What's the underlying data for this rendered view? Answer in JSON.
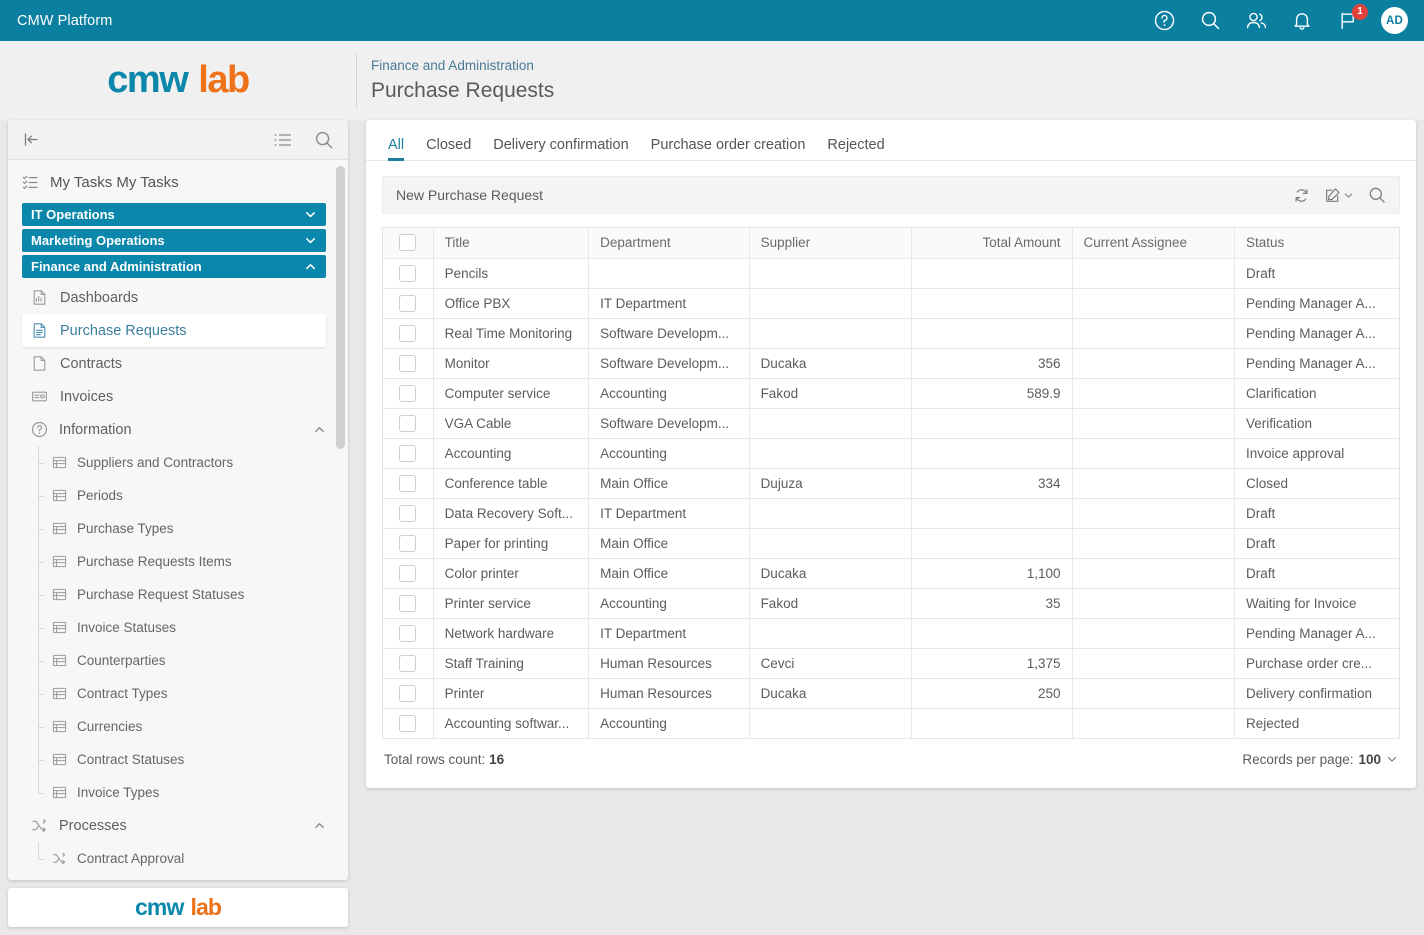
{
  "topbar": {
    "title": "CMW Platform",
    "icons": [
      {
        "name": "help-icon",
        "label": "?"
      },
      {
        "name": "search-icon",
        "label": "Search"
      },
      {
        "name": "people-icon",
        "label": "People"
      },
      {
        "name": "notifications-bell-icon",
        "label": "Notifications"
      },
      {
        "name": "flag-icon",
        "label": "Flags"
      }
    ],
    "flag_badge_count": "1",
    "avatar_initials": "AD",
    "background_color": "#0b7fa0"
  },
  "header": {
    "logo_primary": "cmw",
    "logo_secondary": "lab",
    "breadcrumb": "Finance and Administration",
    "page_title": "Purchase Requests",
    "logo_primary_color": "#0b87ab",
    "logo_secondary_color": "#ee7219"
  },
  "sidebar": {
    "collapse_label": "Collapse",
    "list_view_label": "List view",
    "search_label": "Search",
    "my_tasks": "My Tasks My Tasks",
    "groups": [
      {
        "label": "IT Operations",
        "expanded": false
      },
      {
        "label": "Marketing Operations",
        "expanded": false
      },
      {
        "label": "Finance and Administration",
        "expanded": true
      }
    ],
    "items": [
      {
        "label": "Dashboards",
        "icon": "dashboard-page-icon",
        "active": false
      },
      {
        "label": "Purchase Requests",
        "icon": "document-lines-icon",
        "active": true
      },
      {
        "label": "Contracts",
        "icon": "blank-page-icon",
        "active": false
      },
      {
        "label": "Invoices",
        "icon": "invoice-card-icon",
        "active": false
      }
    ],
    "information_section": {
      "label": "Information",
      "expanded": true,
      "items": [
        "Suppliers and Contractors",
        "Periods",
        "Purchase Types",
        "Purchase Requests Items",
        "Purchase Request Statuses",
        "Invoice Statuses",
        "Counterparties",
        "Contract Types",
        "Currencies",
        "Contract Statuses",
        "Invoice Types"
      ]
    },
    "processes_section": {
      "label": "Processes",
      "expanded": true,
      "items": [
        "Contract Approval"
      ]
    },
    "footer_logo_primary": "cmw",
    "footer_logo_secondary": "lab"
  },
  "main": {
    "tabs": [
      {
        "label": "All",
        "active": true
      },
      {
        "label": "Closed",
        "active": false
      },
      {
        "label": "Delivery confirmation",
        "active": false
      },
      {
        "label": "Purchase order creation",
        "active": false
      },
      {
        "label": "Rejected",
        "active": false
      }
    ],
    "toolbar": {
      "new_record_label": "New Purchase Request",
      "refresh_label": "Refresh",
      "edit_label": "Edit",
      "search_label": "Search"
    },
    "table": {
      "columns": [
        "Title",
        "Department",
        "Supplier",
        "Total Amount",
        "Current Assignee",
        "Status"
      ],
      "rows": [
        {
          "title": "Pencils",
          "department": "",
          "supplier": "",
          "amount": "",
          "assignee": "",
          "status": "Draft"
        },
        {
          "title": "Office PBX",
          "department": "IT Department",
          "supplier": "",
          "amount": "",
          "assignee": "",
          "status": "Pending Manager A..."
        },
        {
          "title": "Real Time Monitoring",
          "department": "Software Developm...",
          "supplier": "",
          "amount": "",
          "assignee": "",
          "status": "Pending Manager A..."
        },
        {
          "title": "Monitor",
          "department": "Software Developm...",
          "supplier": "Ducaka",
          "amount": "356",
          "assignee": "",
          "status": "Pending Manager A..."
        },
        {
          "title": "Computer service",
          "department": "Accounting",
          "supplier": "Fakod",
          "amount": "589.9",
          "assignee": "",
          "status": "Clarification"
        },
        {
          "title": "VGA Cable",
          "department": "Software Developm...",
          "supplier": "",
          "amount": "",
          "assignee": "",
          "status": "Verification"
        },
        {
          "title": "Accounting",
          "department": "Accounting",
          "supplier": "",
          "amount": "",
          "assignee": "",
          "status": "Invoice approval"
        },
        {
          "title": "Conference table",
          "department": "Main Office",
          "supplier": "Dujuza",
          "amount": "334",
          "assignee": "",
          "status": "Closed"
        },
        {
          "title": "Data Recovery Soft...",
          "department": "IT Department",
          "supplier": "",
          "amount": "",
          "assignee": "",
          "status": "Draft"
        },
        {
          "title": "Paper for printing",
          "department": "Main Office",
          "supplier": "",
          "amount": "",
          "assignee": "",
          "status": "Draft"
        },
        {
          "title": "Color printer",
          "department": "Main Office",
          "supplier": "Ducaka",
          "amount": "1,100",
          "assignee": "",
          "status": "Draft"
        },
        {
          "title": "Printer service",
          "department": "Accounting",
          "supplier": "Fakod",
          "amount": "35",
          "assignee": "",
          "status": "Waiting for Invoice"
        },
        {
          "title": "Network hardware",
          "department": "IT Department",
          "supplier": "",
          "amount": "",
          "assignee": "",
          "status": "Pending Manager A..."
        },
        {
          "title": "Staff Training",
          "department": "Human Resources",
          "supplier": "Cevci",
          "amount": "1,375",
          "assignee": "",
          "status": "Purchase order cre..."
        },
        {
          "title": "Printer",
          "department": "Human Resources",
          "supplier": "Ducaka",
          "amount": "250",
          "assignee": "",
          "status": "Delivery confirmation"
        },
        {
          "title": "Accounting softwar...",
          "department": "Accounting",
          "supplier": "",
          "amount": "",
          "assignee": "",
          "status": "Rejected"
        }
      ]
    },
    "footer": {
      "total_rows_label": "Total rows count:",
      "total_rows_value": "16",
      "records_per_page_label": "Records per page:",
      "records_per_page_value": "100"
    }
  }
}
